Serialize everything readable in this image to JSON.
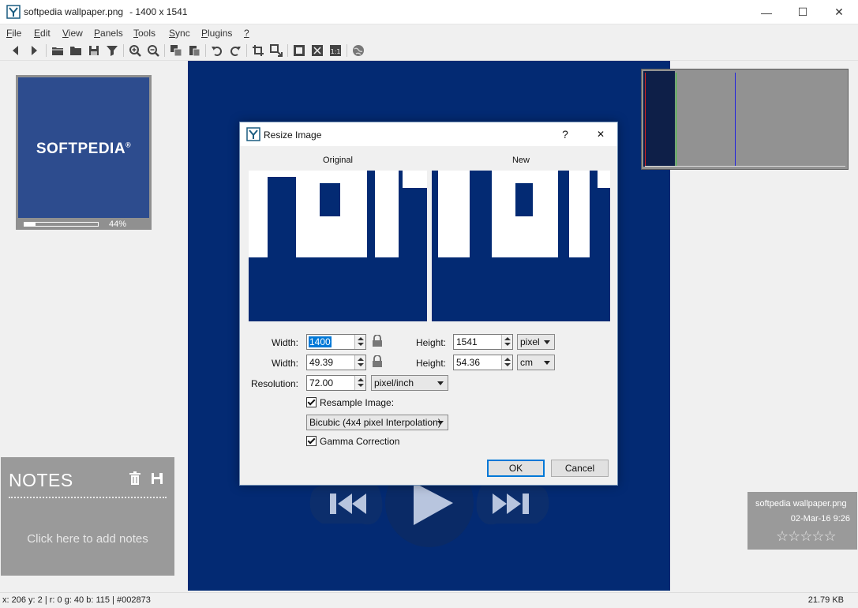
{
  "window": {
    "title": "softpedia wallpaper.png",
    "dimensions": "- 1400 x 1541",
    "minimize": "—",
    "maximize": "☐",
    "close": "✕"
  },
  "menu": {
    "items": [
      {
        "key": "F",
        "rest": "ile"
      },
      {
        "key": "E",
        "rest": "dit"
      },
      {
        "key": "V",
        "rest": "iew"
      },
      {
        "key": "P",
        "rest": "anels"
      },
      {
        "key": "T",
        "rest": "ools"
      },
      {
        "key": "S",
        "rest": "ync"
      },
      {
        "key": "P",
        "rest": "lugins"
      },
      {
        "key": "?",
        "rest": ""
      }
    ]
  },
  "thumbnail": {
    "logo_text": "SOFTPEDIA",
    "logo_mark": "®",
    "zoom_percent": "44%",
    "zoom_fraction": 0.15
  },
  "notes": {
    "title": "NOTES",
    "placeholder": "Click here to add notes"
  },
  "file_info": {
    "name": "softpedia wallpaper.png",
    "date": "02-Mar-16 9:26",
    "rating": 0,
    "stars": "☆☆☆☆☆"
  },
  "status": {
    "coords": "x: 206 y: 2",
    "color": "r: 0 g: 40 b: 115",
    "hex": "#002873",
    "filesize": "21.79 KB"
  },
  "dialog": {
    "title": "Resize Image",
    "help": "?",
    "close": "✕",
    "original_label": "Original",
    "new_label": "New",
    "width_label": "Width:",
    "height_label": "Height:",
    "width_px": "1400",
    "height_px": "1541",
    "unit_px": "pixel",
    "width_label_2": "Width:",
    "height_label_2": "Height:",
    "width_cm": "49.39",
    "height_cm": "54.36",
    "unit_cm": "cm",
    "resolution_label": "Resolution:",
    "resolution": "72.00",
    "resolution_unit": "pixel/inch",
    "resample_label": "Resample Image:",
    "resample_checked": true,
    "interpolation": "Bicubic (4x4 pixel Interpolation)",
    "gamma_label": "Gamma Correction",
    "gamma_checked": true,
    "ok": "OK",
    "cancel": "Cancel"
  },
  "colors": {
    "image_bg": "#032a73",
    "accent": "#0078d7",
    "panel_gray": "#9a9a9a"
  }
}
